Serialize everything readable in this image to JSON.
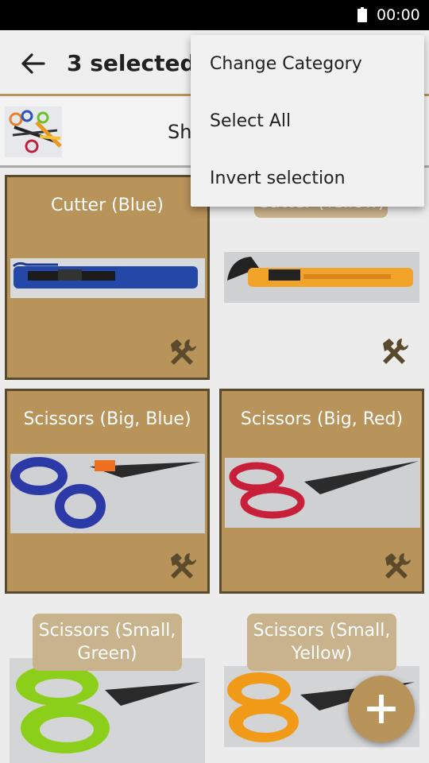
{
  "status_bar": {
    "time": "00:00",
    "battery_icon": "battery-icon"
  },
  "app_bar": {
    "back_icon": "arrow-back-icon",
    "title": "3 selected"
  },
  "category": {
    "label": "Sh",
    "thumb_icon": "scissors-thumbnail"
  },
  "menu": {
    "items": [
      {
        "label": "Change Category"
      },
      {
        "label": "Select All"
      },
      {
        "label": "Invert selection"
      }
    ]
  },
  "grid": {
    "items": [
      {
        "label": "Cutter (Blue)",
        "selected": true,
        "tool_icon": "hammer-wrench-icon"
      },
      {
        "label": "Cutter (Yellow)",
        "selected": false,
        "tool_icon": "hammer-wrench-icon"
      },
      {
        "label": "Scissors (Big, Blue)",
        "selected": true,
        "tool_icon": "hammer-wrench-icon"
      },
      {
        "label": "Scissors (Big, Red)",
        "selected": true,
        "tool_icon": "hammer-wrench-icon"
      },
      {
        "label_line1": "Scissors (Small,",
        "label_line2": "Green)",
        "selected": false
      },
      {
        "label_line1": "Scissors (Small,",
        "label_line2": "Yellow)",
        "selected": false
      }
    ]
  },
  "fab": {
    "icon": "plus-icon"
  },
  "colors": {
    "accent": "#b8935a",
    "selected_border": "#5a4a2e",
    "pill": "#c9b38c"
  }
}
